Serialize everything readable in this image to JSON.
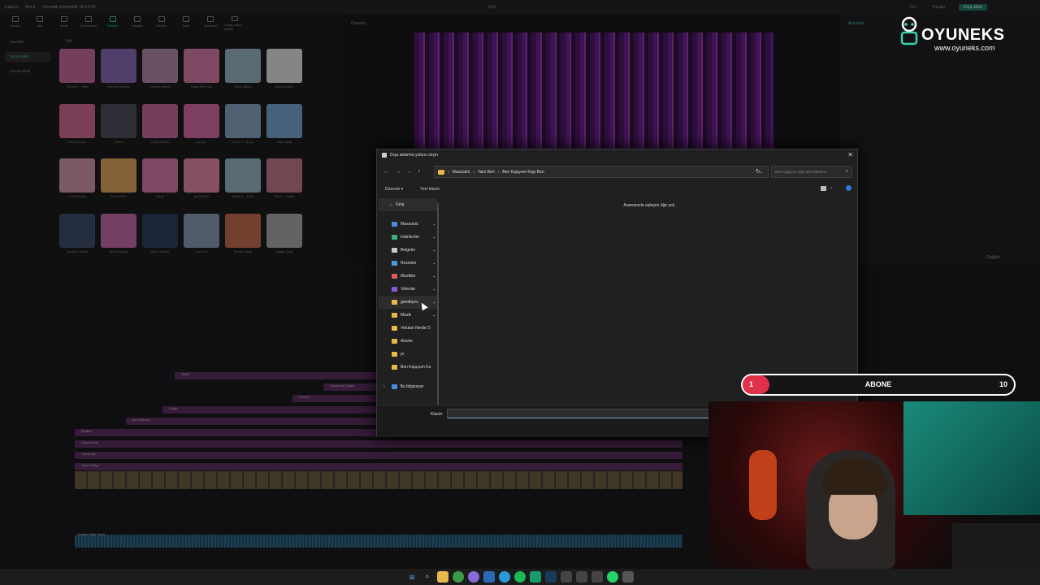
{
  "app": {
    "name": "CapCut",
    "menu": "Menü",
    "status": "Otomatik kaydedildi: 00:19:03",
    "project_title": "1110",
    "pro_label": "Pro",
    "share_label": "Paylaş",
    "export_label": "Dışa aktar",
    "toolbar": [
      "Medya",
      "Ses",
      "Metin",
      "Çıkartmalar",
      "Efektler",
      "Geçişler",
      "Filtreler",
      "Ayar",
      "Şablonlar",
      "Yapay zekâ avatar"
    ],
    "leftnav": [
      "Favoriler",
      "Vücut efekti",
      "Görsel efekti"
    ],
    "section_label": "Yüz",
    "player_title": "Oynatıcı",
    "details_title": "Ayrıntılar",
    "ratio_label": "Değiştir",
    "effect_captions": [
      "Gözal K... Tatlı",
      "Ruhsal Gözlem",
      "Öpücük Meyve",
      "Kalpli Ruh Hali",
      "Mutlu Bakış",
      "Beyaz Bakış",
      "Gözal Çiçek",
      "Retro",
      "Yavaş Çekim",
      "Işıl Işıl",
      "Gözal Y...Boyu",
      "Gece Işığı",
      "Gözal Ekstra",
      "Retro Efekt",
      "Gözal",
      "Işıl Gözlük",
      "Gözal K... Mavi",
      "Neon... Kalbe",
      "Karanlık Ekran",
      "Renkli Işıklar",
      "Akıllı Gözlük",
      "Kıvılcım",
      "Pembe Şekil",
      "Dalga Çizgi"
    ]
  },
  "dialog": {
    "title": "Dışa aktarma yolunu seçin",
    "close_label": "✕",
    "breadcrumb": [
      "Masaüstü",
      "Takıl Beri",
      "Ben Kajuyum Kaju Ben"
    ],
    "search_placeholder": "Ben Kajuyum Kaju Ben klasörü...",
    "organize_label": "Düzenle ▾",
    "new_folder_label": "Yeni klasör",
    "home_label": "Giriş",
    "sidebar_items": [
      {
        "label": "Masaüstü",
        "icon": "desktop-icon",
        "color": "#4a8ad8",
        "pinned": true
      },
      {
        "label": "İndirilenler",
        "icon": "download-icon",
        "color": "#3ab07a",
        "pinned": true
      },
      {
        "label": "Belgeler",
        "icon": "document-icon",
        "color": "#c8c8c8",
        "pinned": true
      },
      {
        "label": "Resimler",
        "icon": "pictures-icon",
        "color": "#4a9ad8",
        "pinned": true
      },
      {
        "label": "Müzikler",
        "icon": "music-icon",
        "color": "#d85a5a",
        "pinned": true
      },
      {
        "label": "Videolar",
        "icon": "video-icon",
        "color": "#8a5ad8",
        "pinned": true
      },
      {
        "label": "goodbyes",
        "icon": "folder-icon",
        "color": "#e8b84a",
        "pinned": true
      },
      {
        "label": "Müzik",
        "icon": "folder-icon",
        "color": "#e8b84a",
        "pinned": true
      },
      {
        "label": "Velutan Nerde D",
        "icon": "folder-icon",
        "color": "#e8b84a",
        "pinned": false
      },
      {
        "label": "Aloske",
        "icon": "folder-icon",
        "color": "#e8b84a",
        "pinned": false
      },
      {
        "label": "pr",
        "icon": "folder-icon",
        "color": "#e8b84a",
        "pinned": false
      },
      {
        "label": "Ben Kajuyum Ka",
        "icon": "folder-icon",
        "color": "#e8b84a",
        "pinned": false
      }
    ],
    "this_pc_label": "Bu bilgisayar",
    "empty_message": "Aramanızla eşleşen öğe yok.",
    "folder_label": "Klasör:",
    "folder_value": ""
  },
  "overlay": {
    "sub_left": "1",
    "sub_center": "ABONE",
    "sub_right": "10",
    "sub_progress": 0.1,
    "logo_text": "OYUNEKS",
    "logo_url": "www.oyuneks.com",
    "accent": "#e0304a",
    "brand": "#3ad0b0"
  },
  "timeline_labels": [
    "Glitch",
    "Kaydırma Çizgisi",
    "Kırılma",
    "Dalga",
    "Işık Sızması",
    "Bulanık",
    "Gözal Renk",
    "Gözal Işık",
    "Siyah Gölge",
    "Retro Kamera",
    "Gözal Tonu"
  ],
  "audio_label": "Kalbim Gelir Yazdı"
}
